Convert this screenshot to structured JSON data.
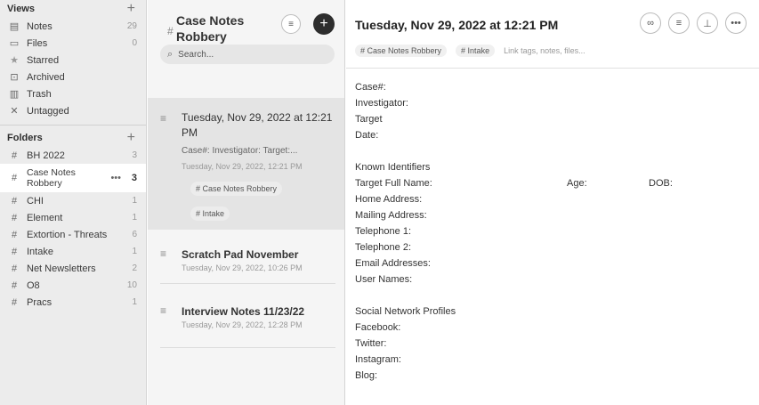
{
  "sidebar": {
    "views_header": "Views",
    "views": [
      {
        "label": "Notes",
        "count": "29",
        "icon": "notes-icon",
        "glyph": "▤"
      },
      {
        "label": "Files",
        "count": "0",
        "icon": "files-icon",
        "glyph": "▭"
      },
      {
        "label": "Starred",
        "count": "",
        "icon": "star-icon",
        "glyph": "★"
      },
      {
        "label": "Archived",
        "count": "",
        "icon": "archive-icon",
        "glyph": "⊡"
      },
      {
        "label": "Trash",
        "count": "",
        "icon": "trash-icon",
        "glyph": "▥"
      },
      {
        "label": "Untagged",
        "count": "",
        "icon": "untagged-icon",
        "glyph": "✕"
      }
    ],
    "folders_header": "Folders",
    "folders": [
      {
        "label": "BH 2022",
        "count": "3"
      },
      {
        "label": "Case Notes Robbery",
        "count": "3",
        "active": true
      },
      {
        "label": "CHI",
        "count": "1"
      },
      {
        "label": "Element",
        "count": "1"
      },
      {
        "label": "Extortion - Threats",
        "count": "6"
      },
      {
        "label": "Intake",
        "count": "1"
      },
      {
        "label": "Net Newsletters",
        "count": "2"
      },
      {
        "label": "O8",
        "count": "10"
      },
      {
        "label": "Pracs",
        "count": "1"
      }
    ]
  },
  "notelist": {
    "title": "Case Notes Robbery",
    "search_placeholder": "Search...",
    "notes": [
      {
        "title": "Tuesday, Nov 29, 2022 at 12:21 PM",
        "snippet": "Case#: Investigator: Target:...",
        "date": "Tuesday, Nov 29, 2022, 12:21 PM",
        "tags": [
          "# Case Notes Robbery",
          "# Intake"
        ]
      },
      {
        "title": "Scratch Pad November",
        "date": "Tuesday, Nov 29, 2022, 10:26 PM"
      },
      {
        "title": "Interview Notes 11/23/22",
        "date": "Tuesday, Nov 29, 2022, 12:28 PM"
      }
    ]
  },
  "editor": {
    "title": "Tuesday, Nov 29, 2022 at 12:21 PM",
    "tags": [
      "# Case Notes Robbery",
      "# Intake"
    ],
    "tag_placeholder": "Link tags, notes, files...",
    "lines": [
      "Case#:",
      "Investigator:",
      "Target",
      "Date:",
      "",
      "Known Identifiers",
      "Target Full Name:",
      "Home Address:",
      "Mailing Address:",
      "Telephone 1:",
      "Telephone 2:",
      "Email Addresses:",
      "User Names:",
      "",
      "Social Network Profiles",
      "Facebook:",
      "Twitter:",
      "Instagram:",
      "Blog:"
    ],
    "age_label": "Age:",
    "dob_label": "DOB:"
  },
  "colors": {
    "sidebar_bg": "#ececec",
    "notelist_bg": "#f5f5f5",
    "selected_card": "#e4e4e4",
    "accent_dark": "#2d2d2d"
  }
}
